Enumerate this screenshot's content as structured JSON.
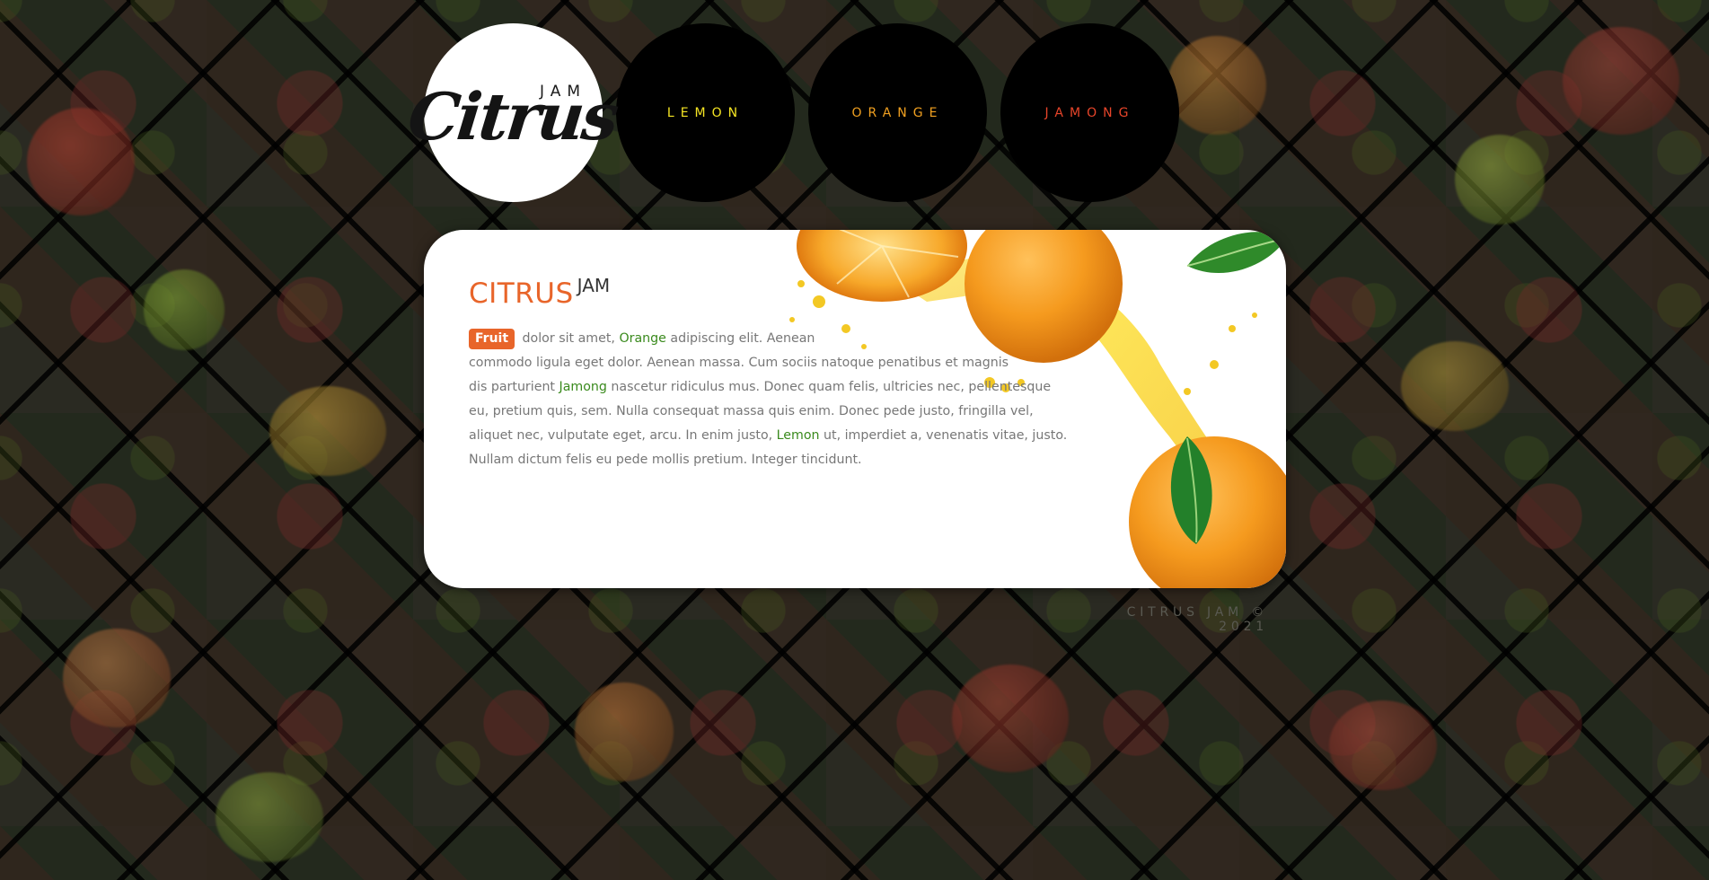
{
  "nav": {
    "logo": {
      "word": "Citrus",
      "sub": "JAM"
    },
    "items": [
      {
        "label": "LEMON",
        "color": "#f5e523"
      },
      {
        "label": "ORANGE",
        "color": "#f0a020"
      },
      {
        "label": "JAMONG",
        "color": "#e8452a"
      }
    ]
  },
  "content": {
    "title": "CITRUS",
    "title_sup": "JAM",
    "badge": "Fruit",
    "text_1": " dolor sit amet, ",
    "kw_orange": "Orange",
    "text_2": " adipiscing elit. Aenean",
    "text_3": "commodo ligula eget dolor. Aenean massa. Cum sociis natoque penatibus et magnis",
    "text_4": "dis parturient ",
    "kw_jamong": "Jamong",
    "text_5": " nascetur ridiculus mus. Donec quam felis, ultricies nec, pellentesque eu, pretium quis, sem. Nulla consequat massa quis enim. Donec pede justo, fringilla vel, aliquet nec, vulputate eget, arcu. In enim justo, ",
    "kw_lemon": "Lemon",
    "text_6": " ut, imperdiet a, venenatis vitae, justo. Nullam dictum felis eu pede mollis pretium. Integer tincidunt."
  },
  "footer": {
    "text": "CITRUS JAM © 2021"
  },
  "colors": {
    "accent": "#e8652a",
    "keyword": "#3a8a1d",
    "lemon": "#f5e523",
    "orange": "#f0a020",
    "jamong": "#e8452a"
  }
}
